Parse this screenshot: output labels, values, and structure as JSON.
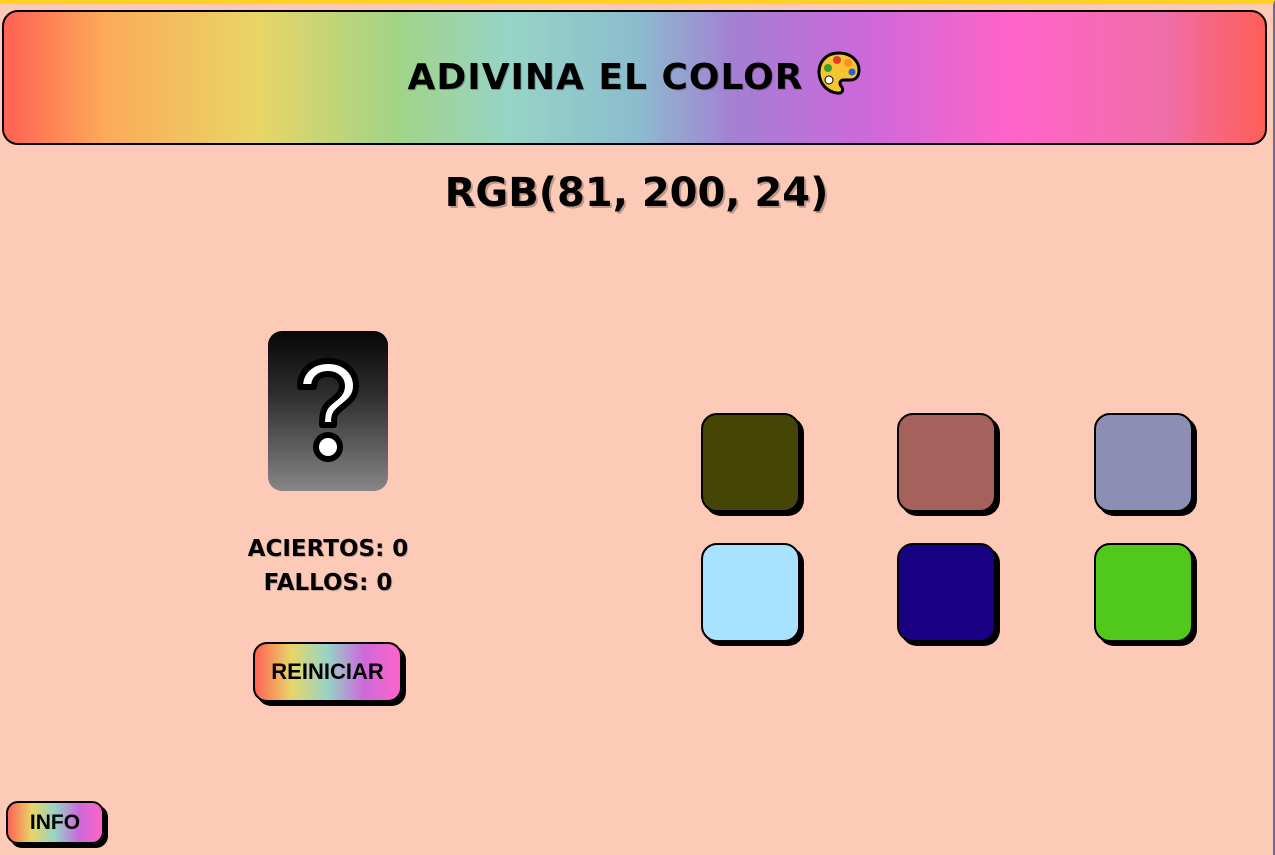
{
  "header": {
    "title": "ADIVINA EL COLOR",
    "icon": "palette-icon"
  },
  "target": {
    "rgb_text": "RGB(81, 200, 24)"
  },
  "mystery_card": {
    "icon": "question-mark-icon"
  },
  "score": {
    "hits_text": "ACIERTOS: 0",
    "misses_text": "FALLOS: 0"
  },
  "buttons": {
    "reset_label": "REINICIAR",
    "info_label": "INFO"
  },
  "swatches": [
    {
      "color": "#454605"
    },
    {
      "color": "#a5625d"
    },
    {
      "color": "#8c8fb3"
    },
    {
      "color": "#a8e2fe"
    },
    {
      "color": "#180183"
    },
    {
      "color": "#50c81c"
    }
  ],
  "colors": {
    "background": "#fdcab8",
    "top_border": "#ffd21f"
  }
}
